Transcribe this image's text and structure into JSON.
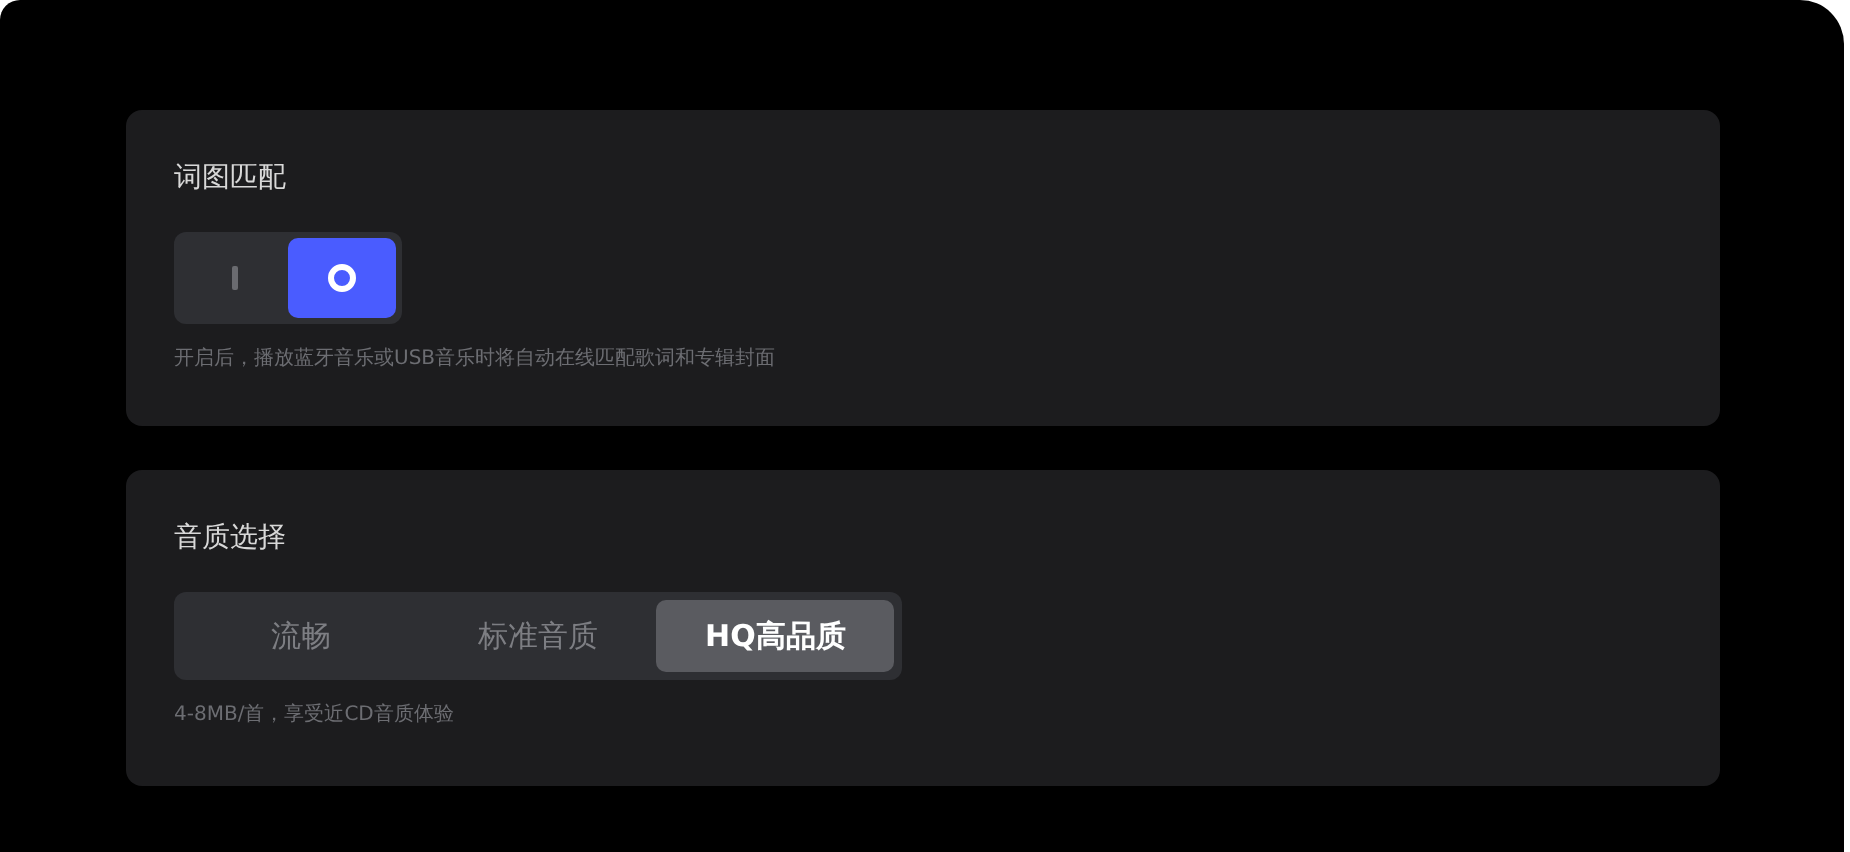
{
  "lyrics_match": {
    "title": "词图匹配",
    "on": true,
    "hint": "开启后，播放蓝牙音乐或USB音乐时将自动在线匹配歌词和专辑封面"
  },
  "sound_quality": {
    "title": "音质选择",
    "options": [
      {
        "label": "流畅",
        "selected": false
      },
      {
        "label": "标准音质",
        "selected": false
      },
      {
        "label": "HQ高品质",
        "selected": true
      }
    ],
    "hint": "4-8MB/首，享受近CD音质体验"
  }
}
